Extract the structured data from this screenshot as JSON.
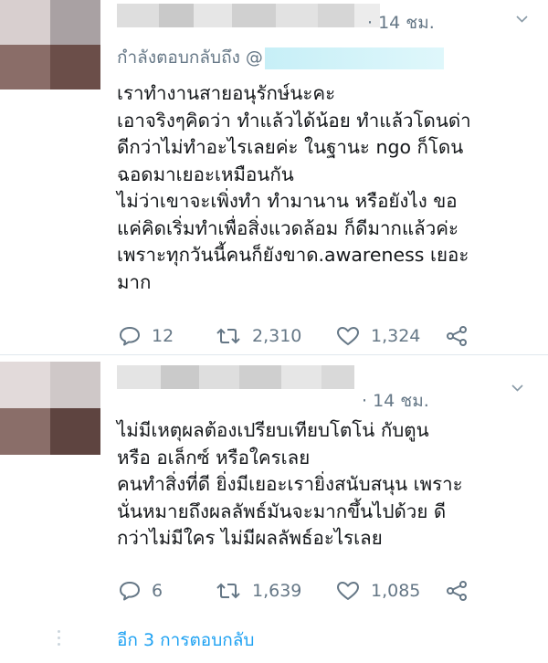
{
  "tweets": [
    {
      "time": "· 14 ชม.",
      "replying_to": "กำลังตอบกลับถึง @",
      "lines": [
        "เราทำงานสายอนุรักษ์นะคะ",
        "เอาจริงๆคิดว่า ทำแล้วได้น้อย ทำแล้วโดนด่า",
        "ดีกว่าไม่ทำอะไรเลยค่ะ ในฐานะ ngo ก็โดน",
        "ฉอดมาเยอะเหมือนกัน",
        "ไม่ว่าเขาจะเพิ่งทำ ทำมานาน หรือยังไง ขอ",
        "แค่คิดเริ่มทำเพื่อสิ่งแวดล้อม ก็ดีมากแล้วค่ะ",
        "เพราะทุกวันนี้คนก็ยังขาด.awareness เยอะ",
        "มาก"
      ],
      "replies": "12",
      "retweets": "2,310",
      "likes": "1,324"
    },
    {
      "time": "· 14 ชม.",
      "lines": [
        "ไม่มีเหตุผลต้องเปรียบเทียบโตโน่ กับตูน",
        "หรือ อเล็กซ์ หรือใครเลย",
        "คนทำสิ่งที่ดี ยิ่งมีเยอะเรายิ่งสนับสนุน เพราะ",
        "นั่นหมายถึงผลลัพธ์มันจะมากขึ้นไปด้วย ดี",
        "กว่าไม่มีใคร ไม่มีผลลัพธ์อะไรเลย"
      ],
      "replies": "6",
      "retweets": "1,639",
      "likes": "1,085"
    }
  ],
  "more_replies": "อีก 3 การตอบกลับ",
  "colors": {
    "text": "#14171a",
    "secondary": "#657786",
    "link": "#1da1f2",
    "divider": "#e1e8ed"
  }
}
